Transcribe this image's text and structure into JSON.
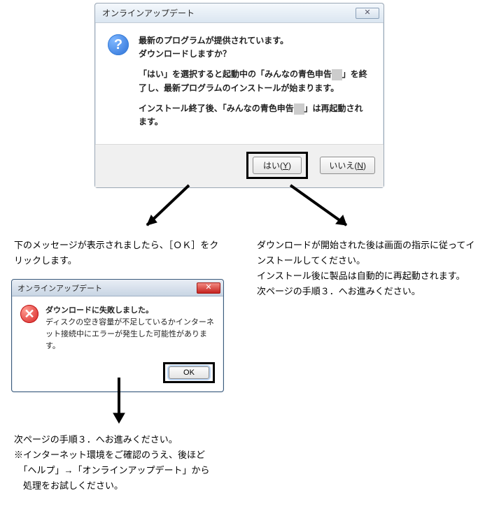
{
  "dialog1": {
    "title": "オンラインアップデート",
    "close_glyph": "✕",
    "question_glyph": "?",
    "line1": "最新のプログラムが提供されています。",
    "line2": "ダウンロードしますか？",
    "line3a": "「はい」を選択すると起動中の「みんなの青色申告",
    "line3b": "」を終了し、最新プログラムのインストールが始まります。",
    "line4a": "インストール終了後、「みんなの青色申告",
    "line4b": "」は再起動されます。",
    "yes_label_pre": "はい(",
    "yes_label_key": "Y",
    "yes_label_post": ")",
    "no_label_pre": "いいえ(",
    "no_label_key": "N",
    "no_label_post": ")"
  },
  "left_text1": "下のメッセージが表示されましたら、［ＯＫ］をクリックします。",
  "dialog2": {
    "title": "オンラインアップデート",
    "close_glyph": "✕",
    "error_glyph": "✕",
    "line1": "ダウンロードに失敗しました。",
    "line2": "ディスクの空き容量が不足しているかインターネット接続中にエラーが発生した可能性があります。",
    "ok_label": "OK"
  },
  "left_text2_l1": "次ページの手順３．へお進みください。",
  "left_text2_l2": "※インターネット環境をご確認のうえ、後ほど",
  "left_text2_l3": "　「ヘルプ」→「オンラインアップデート」から",
  "left_text2_l4": "　処理をお試しください。",
  "right_text_l1": "ダウンロードが開始された後は画面の指示に従ってインストールしてください。",
  "right_text_l2": "インストール後に製品は自動的に再起動されます。",
  "right_text_l3": "次ページの手順３．へお進みください。"
}
